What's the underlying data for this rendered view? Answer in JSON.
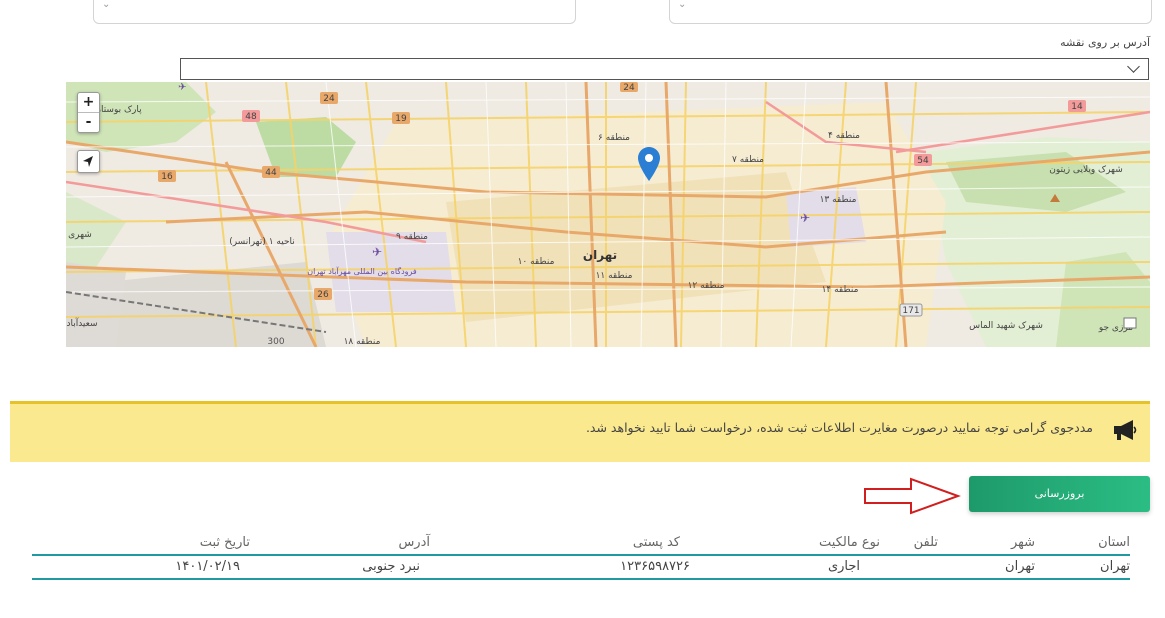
{
  "map_section": {
    "label": "آدرس بر روی نقشه",
    "zoom_in": "+",
    "zoom_out": "-",
    "labels": {
      "tehran": "تهران",
      "mantaghe6": "منطقه ۶",
      "mantaghe7": "منطقه ۷",
      "mantaghe4": "منطقه ۴",
      "mantaghe9": "منطقه ۹",
      "mantaghe10": "منطقه ۱۰",
      "mantaghe11": "منطقه ۱۱",
      "mantaghe12": "منطقه ۱۲",
      "mantaghe13": "منطقه ۱۳",
      "mantaghe14": "منطقه ۱۴",
      "mantaghe18": "منطقه ۱۸",
      "nahiye1": "ناحیه ۱ (تهرانسر)",
      "airport": "فرودگاه بین المللی مهرآباد تهران",
      "shahrak_villa": "شهرک ویلایی زیتون",
      "shahrak_shahid": "شهرک شهید الماس",
      "park": "پارک بوستان",
      "marz": "مرزی جو",
      "rd24a": "24",
      "rd24b": "24",
      "rd48": "48",
      "rd19": "19",
      "rd16": "16",
      "rd44": "44",
      "rd26": "26",
      "rd54": "54",
      "rd14": "14",
      "rd171": "171",
      "rd300": "300",
      "saeedabad": "سعیدآباد",
      "shahr": "شهری"
    }
  },
  "notice": {
    "text": "مددجوی گرامی توجه نمایید درصورت مغایرت اطلاعات ثبت شده، درخواست شما تایید نخواهد شد."
  },
  "update_button": "بروزرسانی",
  "table": {
    "headers": [
      "استان",
      "شهر",
      "تلفن",
      "نوع مالکیت",
      "کد پستی",
      "آدرس",
      "تاریخ ثبت"
    ],
    "rows": [
      [
        "تهران",
        "تهران",
        "",
        "اجاری",
        "۱۲۳۶۵۹۸۷۲۶",
        "نبرد جنوبی",
        "۱۴۰۱/۰۲/۱۹"
      ]
    ]
  },
  "colors": {
    "accent": "#1f9aa0",
    "button_green": "#22a874",
    "notice_bg": "#fbe98f",
    "pin_blue": "#2a7fd4",
    "arrow_red": "#d11f1f"
  }
}
